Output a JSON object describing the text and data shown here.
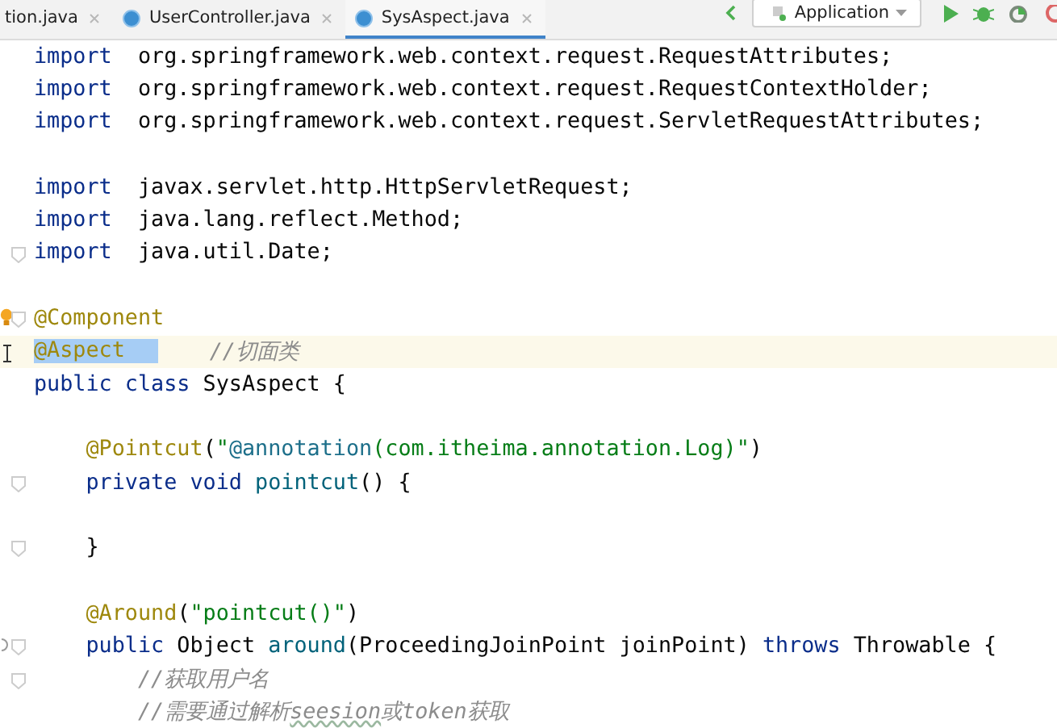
{
  "tabs": [
    {
      "label": "tion.java",
      "icon": false,
      "selected": false
    },
    {
      "label": "UserController.java",
      "icon": true,
      "selected": false
    },
    {
      "label": "SysAspect.java",
      "icon": true,
      "selected": true
    }
  ],
  "run_config": {
    "label": "Application"
  },
  "lines": [
    {
      "fold": false,
      "current": false,
      "segments": [
        {
          "kind": "keyword",
          "text": "import"
        },
        {
          "kind": "plain",
          "text": " org.springframework.web.context.request.RequestAttributes;"
        }
      ]
    },
    {
      "fold": false,
      "current": false,
      "segments": [
        {
          "kind": "keyword",
          "text": "import"
        },
        {
          "kind": "plain",
          "text": " org.springframework.web.context.request.RequestContextHolder;"
        }
      ]
    },
    {
      "fold": false,
      "current": false,
      "segments": [
        {
          "kind": "keyword",
          "text": "import"
        },
        {
          "kind": "plain",
          "text": " org.springframework.web.context.request.ServletRequestAttributes;"
        }
      ]
    },
    {
      "fold": false,
      "current": false
    },
    {
      "fold": false,
      "current": false,
      "segments": [
        {
          "kind": "keyword",
          "text": "import"
        },
        {
          "kind": "plain",
          "text": " javax.servlet.http.HttpServletRequest;"
        }
      ]
    },
    {
      "fold": false,
      "current": false,
      "segments": [
        {
          "kind": "keyword",
          "text": "import"
        },
        {
          "kind": "plain",
          "text": " java.lang.reflect.Method;"
        }
      ]
    },
    {
      "fold": true,
      "current": false,
      "segments": [
        {
          "kind": "keyword",
          "text": "import"
        },
        {
          "kind": "plain",
          "text": " java.util.Date;"
        }
      ]
    },
    {
      "fold": false,
      "current": false
    },
    {
      "fold": true,
      "current": false,
      "segments": [
        {
          "kind": "annotation",
          "text": "@Component"
        }
      ]
    },
    {
      "fold": false,
      "current": true,
      "segments": [
        {
          "kind": "selected-annotation",
          "text": "@Aspect"
        },
        {
          "kind": "comment",
          "text": "//切面类"
        }
      ]
    },
    {
      "fold": false,
      "current": false,
      "segments": [
        {
          "kind": "keyword",
          "text": "public class"
        },
        {
          "kind": "plain",
          "text": "SysAspect {"
        }
      ]
    },
    {
      "fold": false,
      "current": false
    },
    {
      "fold": false,
      "current": false,
      "segments": [
        {
          "kind": "annotation",
          "text": "    @Pointcut"
        },
        {
          "kind": "plain",
          "text": "("
        },
        {
          "kind": "string",
          "text": "\""
        },
        {
          "kind": "injected",
          "text": "@annotation"
        },
        {
          "kind": "string",
          "text": "(com.itheima.annotation.Log)\""
        },
        {
          "kind": "plain",
          "text": ")"
        }
      ]
    },
    {
      "fold": true,
      "current": false,
      "segments": [
        {
          "kind": "keyword",
          "text": "    private void"
        },
        {
          "kind": "method",
          "text": "pointcut"
        },
        {
          "kind": "plain",
          "text": "() {"
        }
      ]
    },
    {
      "fold": false,
      "current": false
    },
    {
      "fold": true,
      "current": false,
      "segments": [
        {
          "kind": "plain",
          "text": "    }"
        }
      ]
    },
    {
      "fold": false,
      "current": false
    },
    {
      "fold": false,
      "current": false,
      "segments": [
        {
          "kind": "annotation",
          "text": "    @Around"
        },
        {
          "kind": "plain",
          "text": "("
        },
        {
          "kind": "string",
          "text": "\"pointcut()\""
        },
        {
          "kind": "plain",
          "text": ")"
        }
      ]
    },
    {
      "fold": true,
      "current": false,
      "segments": [
        {
          "kind": "keyword",
          "text": "    public"
        },
        {
          "kind": "plain",
          "text": "Object"
        },
        {
          "kind": "method",
          "text": "around"
        },
        {
          "kind": "plain",
          "text": "(ProceedingJoinPoint joinPoint)"
        },
        {
          "kind": "keyword",
          "text": "throws"
        },
        {
          "kind": "plain",
          "text": "Throwable {"
        }
      ]
    },
    {
      "fold": true,
      "current": false,
      "segments": [
        {
          "kind": "comment",
          "text": "        //获取用户名"
        }
      ]
    },
    {
      "fold": false,
      "current": false,
      "segments": [
        {
          "kind": "comment",
          "text": "        //需要通过解析"
        },
        {
          "kind": "typo-comment",
          "text": "seesion"
        },
        {
          "kind": "comment",
          "text": "或token获取"
        }
      ]
    }
  ]
}
